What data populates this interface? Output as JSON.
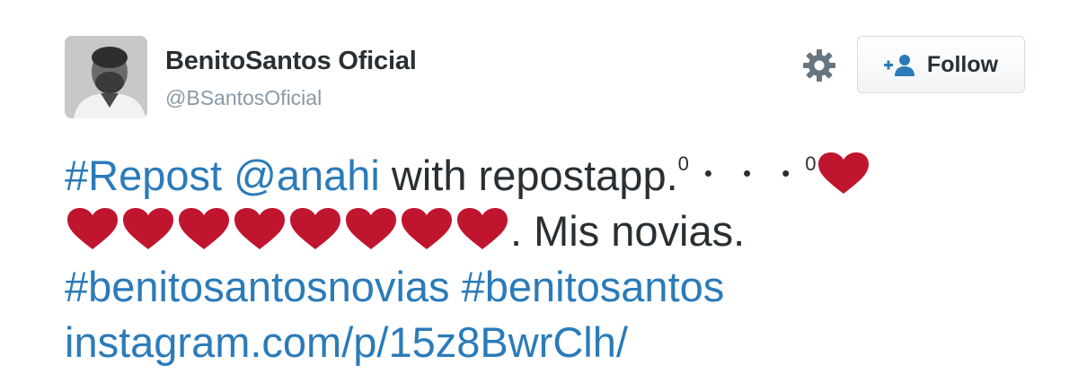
{
  "user": {
    "display_name": "BenitoSantos Oficial",
    "handle": "@BSantosOficial"
  },
  "actions": {
    "settings_icon": "gear-icon",
    "follow_label": "Follow",
    "follow_icon": "add-user-icon"
  },
  "tweet": {
    "line1": {
      "hashtag": "#Repost",
      "mention": "@anahi",
      "text": " with repostapp.",
      "count_a": "0",
      "count_b": "0",
      "dot": "•"
    },
    "line2": {
      "hearts": 8,
      "text": ". Mis novias."
    },
    "hashtags": [
      "#benitosantosnovias",
      "#benitosantos"
    ],
    "link": "instagram.com/p/15z8BwrClh/"
  },
  "colors": {
    "link": "#2b7bb9",
    "text": "#292f33",
    "muted": "#8899a6",
    "heart": "#c0152f"
  }
}
